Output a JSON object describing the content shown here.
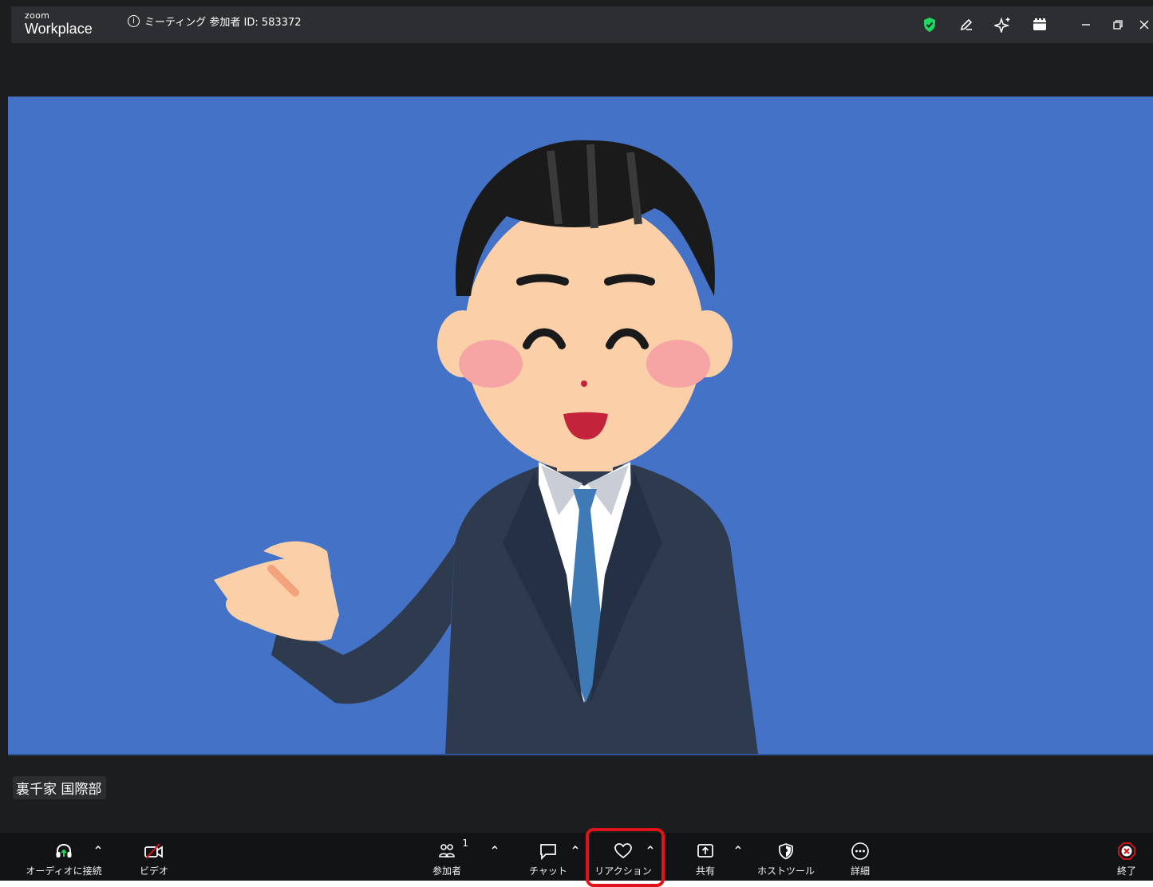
{
  "app": {
    "logo_small": "zoom",
    "logo_large": "Workplace"
  },
  "titlebar": {
    "meeting_label": "ミーティング 参加者 ID: 583372",
    "icons": [
      "shield-check-icon",
      "pen-icon",
      "sparkle-icon",
      "apps-icon",
      "minimize-icon",
      "restore-icon",
      "close-icon"
    ]
  },
  "participant": {
    "name": "裏千家 国際部"
  },
  "toolbar": {
    "audio_label": "オーディオに接続",
    "video_label": "ビデオ",
    "participants_label": "参加者",
    "participants_count": "1",
    "chat_label": "チャット",
    "reactions_label": "リアクション",
    "share_label": "共有",
    "hosttools_label": "ホストツール",
    "more_label": "詳細",
    "end_label": "終了"
  },
  "colors": {
    "highlight": "#e0131a",
    "shield": "#1ed760",
    "video_bg": "#4472c6",
    "end": "#e0131a"
  }
}
